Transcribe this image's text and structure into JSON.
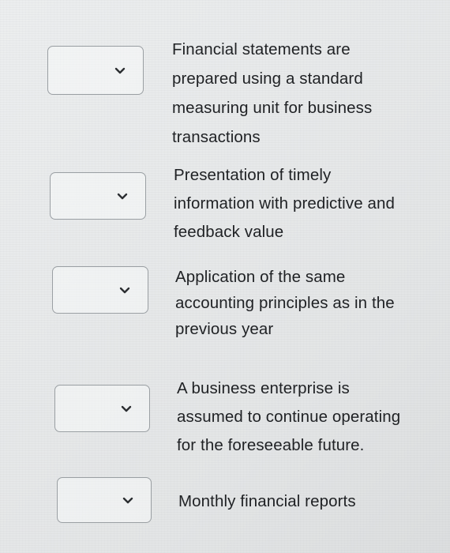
{
  "items": [
    {
      "text": "Financial statements are\nprepared using a standard\nmeasuring unit for   business\ntransactions",
      "dropdown_value": "",
      "chevron_icon": "chevron-down-icon"
    },
    {
      "text": "Presentation of timely\ninformation with predictive and\nfeedback value",
      "dropdown_value": "",
      "chevron_icon": "chevron-down-icon"
    },
    {
      "text": "Application of the same\naccounting principles as in the\nprevious year",
      "dropdown_value": "",
      "chevron_icon": "chevron-down-icon"
    },
    {
      "text": "A business enterprise is\nassumed to continue operating\nfor the foreseeable future.",
      "dropdown_value": "",
      "chevron_icon": "chevron-down-icon"
    },
    {
      "text": "Monthly financial reports",
      "dropdown_value": "",
      "chevron_icon": "chevron-down-icon"
    }
  ]
}
